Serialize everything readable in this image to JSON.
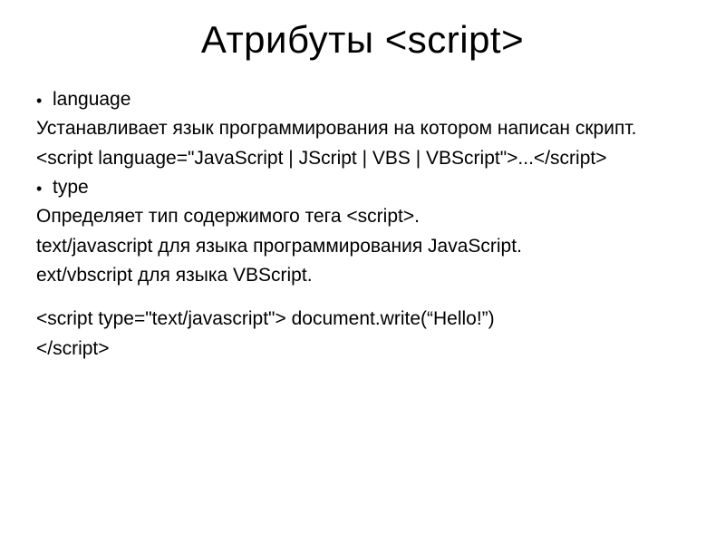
{
  "title": "Атрибуты <script>",
  "lines": [
    {
      "type": "bullet",
      "text": "language"
    },
    {
      "type": "plain",
      "text": "Устанавливает язык программирования на котором написан скрипт."
    },
    {
      "type": "plain",
      "text": "<script language=\"JavaScript | JScript | VBS | VBScript\">...</script>"
    },
    {
      "type": "bullet",
      "text": "type"
    },
    {
      "type": "plain",
      "text": "Определяет тип содержимого тега <script>."
    },
    {
      "type": "plain",
      "text": "text/javascript для языка программирования JavaScript."
    },
    {
      "type": "plain",
      "text": "ext/vbscript для языка VBScript."
    },
    {
      "type": "gap"
    },
    {
      "type": "plain",
      "text": "<script type=\"text/javascript\">   document.write(“Hello!”)"
    },
    {
      "type": "plain",
      "text": "</script>"
    }
  ]
}
